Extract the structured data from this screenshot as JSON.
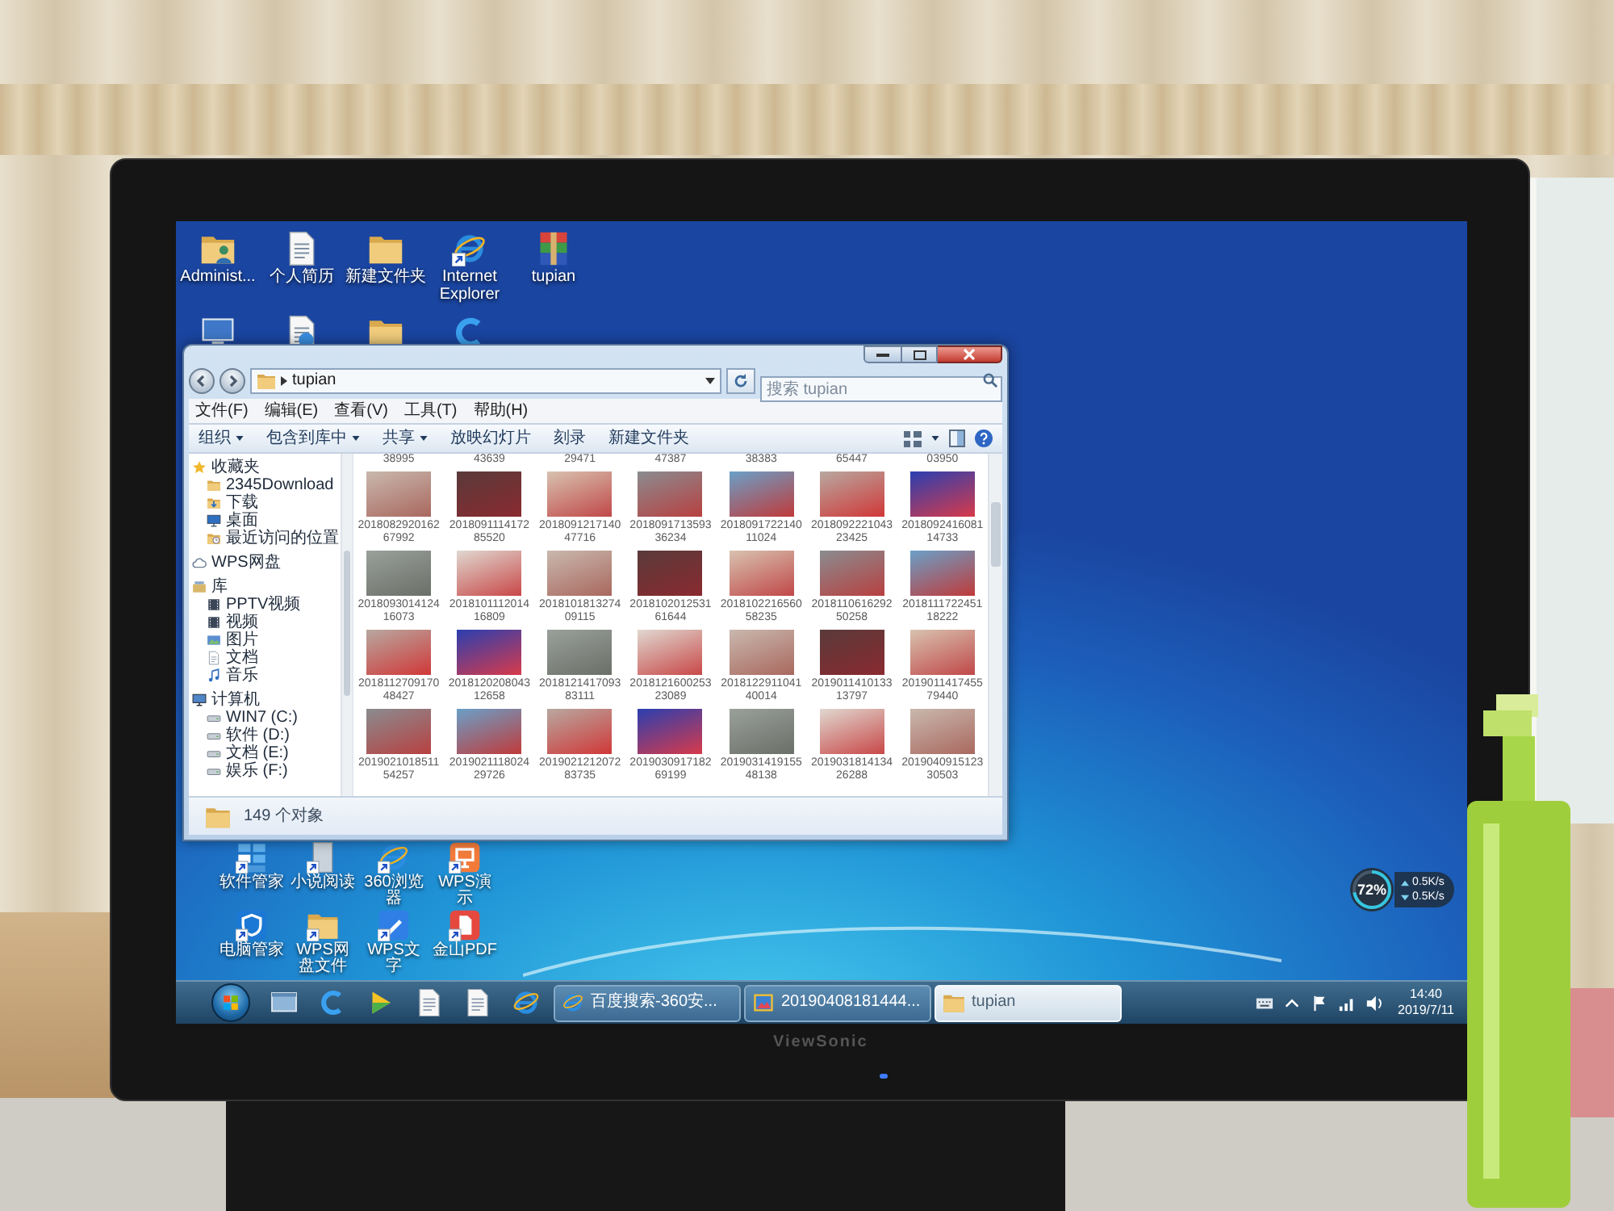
{
  "monitor": {
    "brand": "ViewSonic"
  },
  "desktop": {
    "top_icons": [
      {
        "label": "Administ...",
        "kind": "user-folder",
        "shortcut": false
      },
      {
        "label": "个人简历",
        "kind": "document",
        "shortcut": false
      },
      {
        "label": "新建文件夹",
        "kind": "folder",
        "shortcut": false
      },
      {
        "label": "Internet Explorer",
        "kind": "browser",
        "shortcut": true
      },
      {
        "label": "tupian",
        "kind": "archive",
        "shortcut": false
      }
    ],
    "bottom_icons": [
      {
        "label": "软件管家",
        "kind": "tiles",
        "shortcut": true
      },
      {
        "label": "小说阅读",
        "kind": "page",
        "shortcut": true
      },
      {
        "label": "360浏览器",
        "kind": "browser",
        "shortcut": true
      },
      {
        "label": "WPS演示",
        "kind": "presentation",
        "shortcut": true
      },
      {
        "label": "电脑管家",
        "kind": "shield",
        "shortcut": true
      },
      {
        "label": "WPS网盘文件",
        "kind": "folder",
        "shortcut": true
      },
      {
        "label": "WPS文字",
        "kind": "writer",
        "shortcut": true
      },
      {
        "label": "金山PDF",
        "kind": "pdf",
        "shortcut": true
      }
    ]
  },
  "explorer": {
    "address": "tupian",
    "search": {
      "placeholder": "搜索 tupian"
    },
    "menu": [
      "文件(F)",
      "编辑(E)",
      "查看(V)",
      "工具(T)",
      "帮助(H)"
    ],
    "toolbar": [
      {
        "label": "组织",
        "dropdown": true
      },
      {
        "label": "包含到库中",
        "dropdown": true
      },
      {
        "label": "共享",
        "dropdown": true
      },
      {
        "label": "放映幻灯片",
        "dropdown": false
      },
      {
        "label": "刻录",
        "dropdown": false
      },
      {
        "label": "新建文件夹",
        "dropdown": false
      }
    ],
    "sidebar": [
      {
        "label": "收藏夹",
        "kind": "favorites",
        "children": [
          {
            "label": "2345Download",
            "kind": "folder"
          },
          {
            "label": "下载",
            "kind": "downloads"
          },
          {
            "label": "桌面",
            "kind": "desktop"
          },
          {
            "label": "最近访问的位置",
            "kind": "recent"
          }
        ]
      },
      {
        "label": "WPS网盘",
        "kind": "cloud"
      },
      {
        "label": "库",
        "kind": "library",
        "children": [
          {
            "label": "PPTV视频",
            "kind": "video"
          },
          {
            "label": "视频",
            "kind": "video"
          },
          {
            "label": "图片",
            "kind": "pictures"
          },
          {
            "label": "文档",
            "kind": "documents"
          },
          {
            "label": "音乐",
            "kind": "music"
          }
        ]
      },
      {
        "label": "计算机",
        "kind": "computer",
        "children": [
          {
            "label": "WIN7 (C:)",
            "kind": "drive"
          },
          {
            "label": "软件 (D:)",
            "kind": "drive"
          },
          {
            "label": "文档 (E:)",
            "kind": "drive"
          },
          {
            "label": "娱乐 (F:)",
            "kind": "drive"
          }
        ]
      }
    ],
    "files": {
      "cut_row": [
        "38995",
        "43639",
        "29471",
        "47387",
        "38383",
        "65447",
        "03950"
      ],
      "items": [
        "201808292016267992",
        "201809111417285520",
        "201809121714047716",
        "201809171359336234",
        "201809172214011024",
        "201809222104323425",
        "201809241608114733",
        "201809301412416073",
        "201810111201416809",
        "201810181327409115",
        "201810201253161644",
        "201810221656058235",
        "201811061629250258",
        "201811172245118222",
        "201811270917048427",
        "201812020804312658",
        "201812141709383111",
        "201812160025323089",
        "201812291104140014",
        "201901141013313797",
        "201901141745579440",
        "201902101851154257",
        "201902111802429726",
        "201902121207283735",
        "201903091718269199",
        "201903141915548138",
        "201903181413426288",
        "201904091512330503"
      ]
    },
    "status": "149 个对象"
  },
  "gadget": {
    "percent": "72%",
    "level": 0.72,
    "upload": "0.5K/s",
    "download": "0.5K/s"
  },
  "taskbar": {
    "tasks": [
      {
        "label": "百度搜索-360安...",
        "kind": "browser",
        "selected": false
      },
      {
        "label": "20190408181444...",
        "kind": "image",
        "selected": false
      },
      {
        "label": "tupian",
        "kind": "folder",
        "selected": true
      }
    ],
    "clock": {
      "time": "14:40",
      "date": "2019/7/11"
    }
  }
}
